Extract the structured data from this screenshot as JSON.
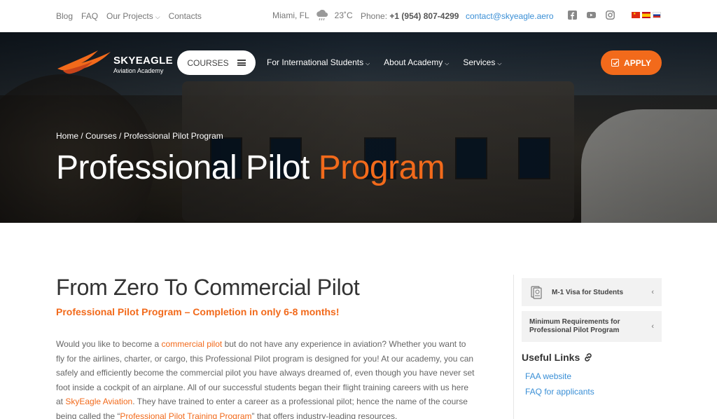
{
  "topbar": {
    "links": [
      "Blog",
      "FAQ",
      "Our Projects",
      "Contacts"
    ],
    "location": "Miami, FL",
    "temperature": "23˚C",
    "phone_label": "Phone:",
    "phone_number": "+1 (954) 807-4299",
    "email": "contact@skyeagle.aero",
    "social_icons": [
      "facebook-icon",
      "youtube-icon",
      "instagram-icon"
    ],
    "flags": [
      "china-flag-icon",
      "spain-flag-icon",
      "russia-flag-icon"
    ]
  },
  "nav": {
    "logo_sky": "SKY",
    "logo_eagle": "EAGLE",
    "logo_sub": "Aviation Academy",
    "courses_label": "COURSES",
    "items": [
      "For International Students",
      "About Academy",
      "Services"
    ],
    "apply_label": "APPLY"
  },
  "hero": {
    "breadcrumb": "Home / Courses / Professional Pilot Program",
    "title_main": "Professional Pilot ",
    "title_highlight": "Program"
  },
  "content": {
    "heading": "From Zero To Commercial Pilot",
    "subtitle": "Professional Pilot Program – Completion in only 6-8 months!",
    "p1_a": "Would you like to become a ",
    "p1_link1": "commercial pilot",
    "p1_b": " but do not have any experience in aviation? Whether you want to fly for the airlines, charter, or cargo, this Professional Pilot program is designed for you! At our academy, you can safely and efficiently become the commercial pilot you have always dreamed of, even though you have never set foot inside a cockpit of an airplane. All of our successful students began their flight training careers with us here at ",
    "p1_link2": "SkyEagle Aviation",
    "p1_c": ". They have trained to enter a career as a professional pilot; hence the name of the course being called the “",
    "p1_link3": "Professional Pilot Training Program",
    "p1_d": "” that offers industry-leading resources."
  },
  "sidebar": {
    "cards": [
      "M-1 Visa for Students",
      "Minimum Requirements for Professional Pilot Program"
    ],
    "useful_title": "Useful Links",
    "useful_links": [
      "FAA website",
      "FAQ for applicants"
    ]
  },
  "colors": {
    "accent": "#f26a1b",
    "link_blue": "#3a8fd6"
  }
}
